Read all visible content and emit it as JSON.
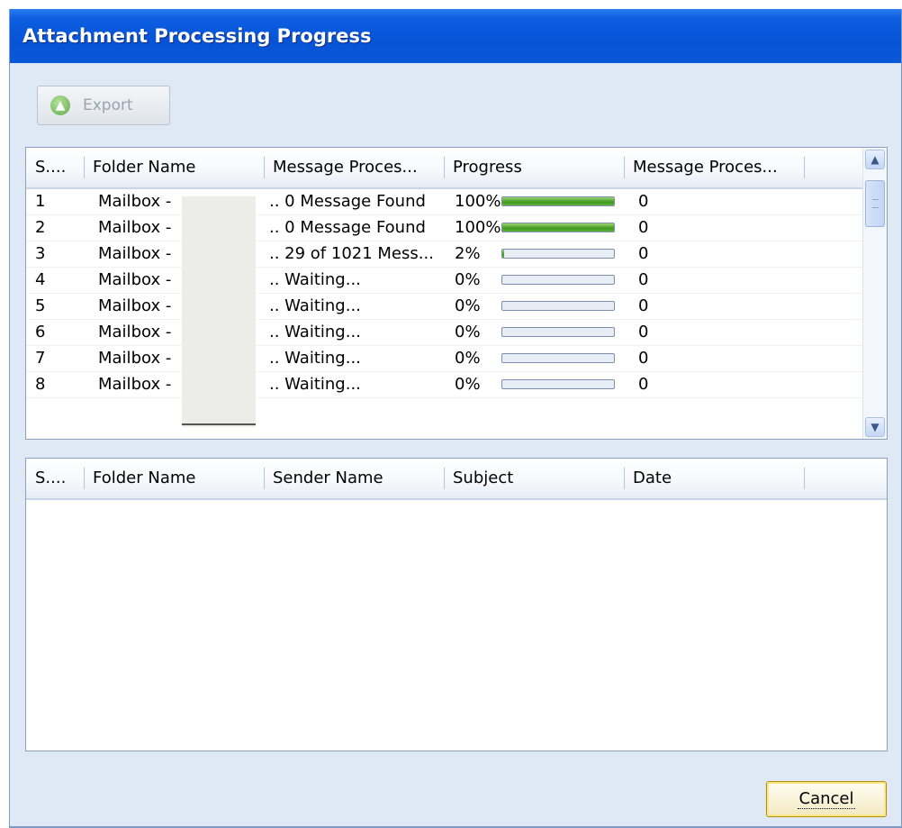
{
  "window": {
    "title": "Attachment Processing Progress"
  },
  "toolbar": {
    "export_label": "Export",
    "export_icon": "up-arrow-icon"
  },
  "processing_table": {
    "columns": [
      "S....",
      "Folder Name",
      "Message Proces...",
      "Progress",
      "Message Proces..."
    ],
    "rows": [
      {
        "sno": "1",
        "folder": "Mailbox - ",
        "status": "0 Message Found",
        "percent_text": "100%",
        "percent": 100,
        "count": "0"
      },
      {
        "sno": "2",
        "folder": "Mailbox - ",
        "status": "0 Message Found",
        "percent_text": "100%",
        "percent": 100,
        "count": "0"
      },
      {
        "sno": "3",
        "folder": "Mailbox - ",
        "status": "29 of 1021 Mess...",
        "percent_text": "2%",
        "percent": 2,
        "count": "0"
      },
      {
        "sno": "4",
        "folder": "Mailbox - ",
        "status": "Waiting...",
        "percent_text": "0%",
        "percent": 0,
        "count": "0"
      },
      {
        "sno": "5",
        "folder": "Mailbox - ",
        "status": "Waiting...",
        "percent_text": "0%",
        "percent": 0,
        "count": "0"
      },
      {
        "sno": "6",
        "folder": "Mailbox - ",
        "status": "Waiting...",
        "percent_text": "0%",
        "percent": 0,
        "count": "0"
      },
      {
        "sno": "7",
        "folder": "Mailbox - ",
        "status": "Waiting...",
        "percent_text": "0%",
        "percent": 0,
        "count": "0"
      },
      {
        "sno": "8",
        "folder": "Mailbox - ",
        "status": "Waiting...",
        "percent_text": "0%",
        "percent": 0,
        "count": "0"
      }
    ]
  },
  "results_table": {
    "columns": [
      "S....",
      "Folder Name",
      "Sender Name",
      "Subject",
      "Date"
    ]
  },
  "footer": {
    "cancel_label": "Cancel"
  },
  "colors": {
    "title_bar": "#0753d6",
    "progress_fill": "#3f9a20",
    "window_bg": "#dfe9f5"
  }
}
